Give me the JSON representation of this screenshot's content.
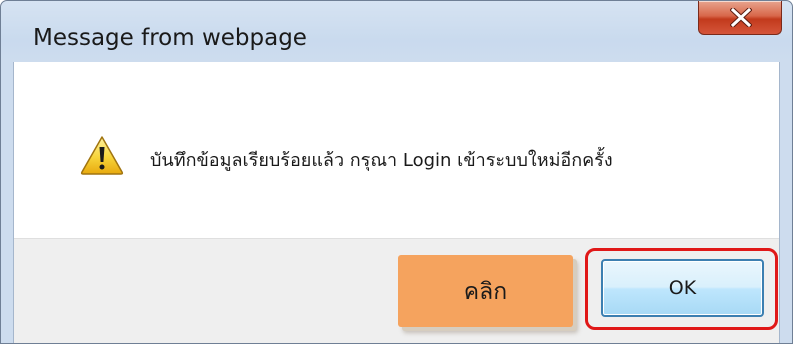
{
  "dialog": {
    "title": "Message from webpage",
    "message": "บันทึกข้อมูลเรียบร้อยแล้ว กรุณา Login เข้าระบบใหม่อีกครั้ง",
    "icon": "warning-icon",
    "close_icon": "close-icon"
  },
  "buttons": {
    "ok_label": "OK"
  },
  "annotation": {
    "click_label": "คลิก",
    "tag_color": "#f5a35e",
    "highlight_color": "#e01818"
  }
}
